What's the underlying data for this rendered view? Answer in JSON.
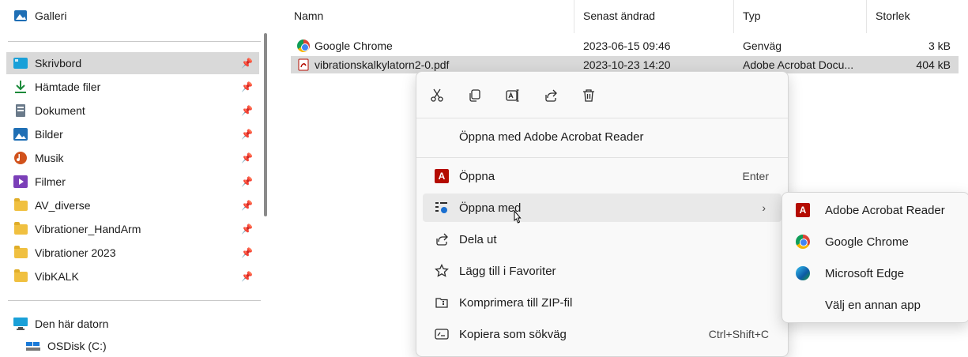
{
  "nav": {
    "top_item": "Galleri",
    "items": [
      {
        "label": "Skrivbord",
        "icon": "desktop-icon"
      },
      {
        "label": "Hämtade filer",
        "icon": "download-icon"
      },
      {
        "label": "Dokument",
        "icon": "document-icon"
      },
      {
        "label": "Bilder",
        "icon": "pictures-icon"
      },
      {
        "label": "Musik",
        "icon": "music-icon"
      },
      {
        "label": "Filmer",
        "icon": "video-icon"
      },
      {
        "label": "AV_diverse",
        "icon": "folder-icon"
      },
      {
        "label": "Vibrationer_HandArm",
        "icon": "folder-icon"
      },
      {
        "label": "Vibrationer 2023",
        "icon": "folder-icon"
      },
      {
        "label": "VibKALK",
        "icon": "folder-icon"
      }
    ],
    "pc": "Den här datorn",
    "disk": "OSDisk (C:)"
  },
  "list": {
    "columns": [
      "Namn",
      "Senast ändrad",
      "Typ",
      "Storlek"
    ],
    "rows": [
      {
        "name": "Google Chrome",
        "modified": "2023-06-15 09:46",
        "type": "Genväg",
        "size": "3 kB"
      },
      {
        "name": "vibrationskalkylatorn2-0.pdf",
        "modified": "2023-10-23 14:20",
        "type": "Adobe Acrobat Docu...",
        "size": "404 kB"
      }
    ]
  },
  "menu": {
    "quick_actions": [
      "cut-icon",
      "copy-icon",
      "rename-icon",
      "share-icon",
      "delete-icon"
    ],
    "open_with_default": "Öppna med Adobe Acrobat Reader",
    "open": "Öppna",
    "open_shortcut": "Enter",
    "open_with": "Öppna med",
    "share": "Dela ut",
    "favorites": "Lägg till i Favoriter",
    "zip": "Komprimera till ZIP-fil",
    "copy_path": "Kopiera som sökväg",
    "copy_path_shortcut": "Ctrl+Shift+C"
  },
  "submenu": {
    "items": [
      "Adobe Acrobat Reader",
      "Google Chrome",
      "Microsoft Edge",
      "Välj en annan app"
    ]
  }
}
